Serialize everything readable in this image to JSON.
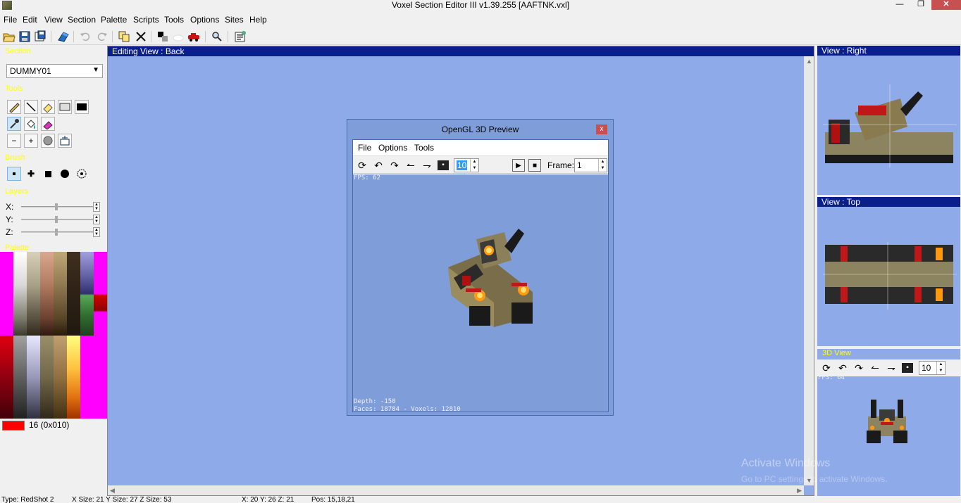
{
  "window": {
    "title": "Voxel Section Editor III v1.39.255 [AAFTNK.vxl]",
    "min_glyph": "—",
    "max_glyph": "❐",
    "close_glyph": "✕"
  },
  "menu": [
    "File",
    "Edit",
    "View",
    "Section",
    "Palette",
    "Scripts",
    "Tools",
    "Options",
    "Sites",
    "Help"
  ],
  "toolbar": {
    "icons": [
      "open-icon",
      "save-icon",
      "save-as-icon",
      "export-icon",
      "undo-icon",
      "redo-icon",
      "copy-icon",
      "clear-icon",
      "split-icon",
      "unknown-icon",
      "vehicle-icon",
      "magnify-icon",
      "properties-icon"
    ]
  },
  "left": {
    "section_label": "Section",
    "section_value": "DUMMY01",
    "tools_label": "Tools",
    "brush_label": "Brush",
    "layers_label": "Layers",
    "palette_label": "Palette",
    "layers": [
      {
        "label": "X:"
      },
      {
        "label": "Y:"
      },
      {
        "label": "Z:"
      }
    ],
    "selected_color_label": "16 (0x010)",
    "selected_color": "#ff0000"
  },
  "edit_view": {
    "title": "Editing View : Back"
  },
  "preview": {
    "title": "OpenGL 3D Preview",
    "close": "x",
    "menu": [
      "File",
      "Options",
      "Tools"
    ],
    "speed_value": "10",
    "frame_label": "Frame:",
    "frame_value": "1",
    "fps": "FPS: 62",
    "depth": "Depth: -150",
    "faces": "Faces: 18784 - Voxels: 12810"
  },
  "right": {
    "view_right_title": "View : Right",
    "view_top_title": "View : Top",
    "view3d_label": "3D View",
    "view3d_speed": "10",
    "view3d_fps": "FPS: 64"
  },
  "status": {
    "type": "Type: RedShot 2",
    "sizes": "X Size: 21  Y Size: 27  Z Size: 53",
    "coords": "X: 20  Y: 26  Z: 21",
    "pos": "Pos: 15,18,21"
  },
  "watermark": {
    "line1": "Activate Windows",
    "line2": "Go to PC settings to activate Windows."
  },
  "colors": {
    "title_blue": "#0a1e8c",
    "canvas_blue": "#8eaae8",
    "label_yellow": "#ffff00"
  }
}
